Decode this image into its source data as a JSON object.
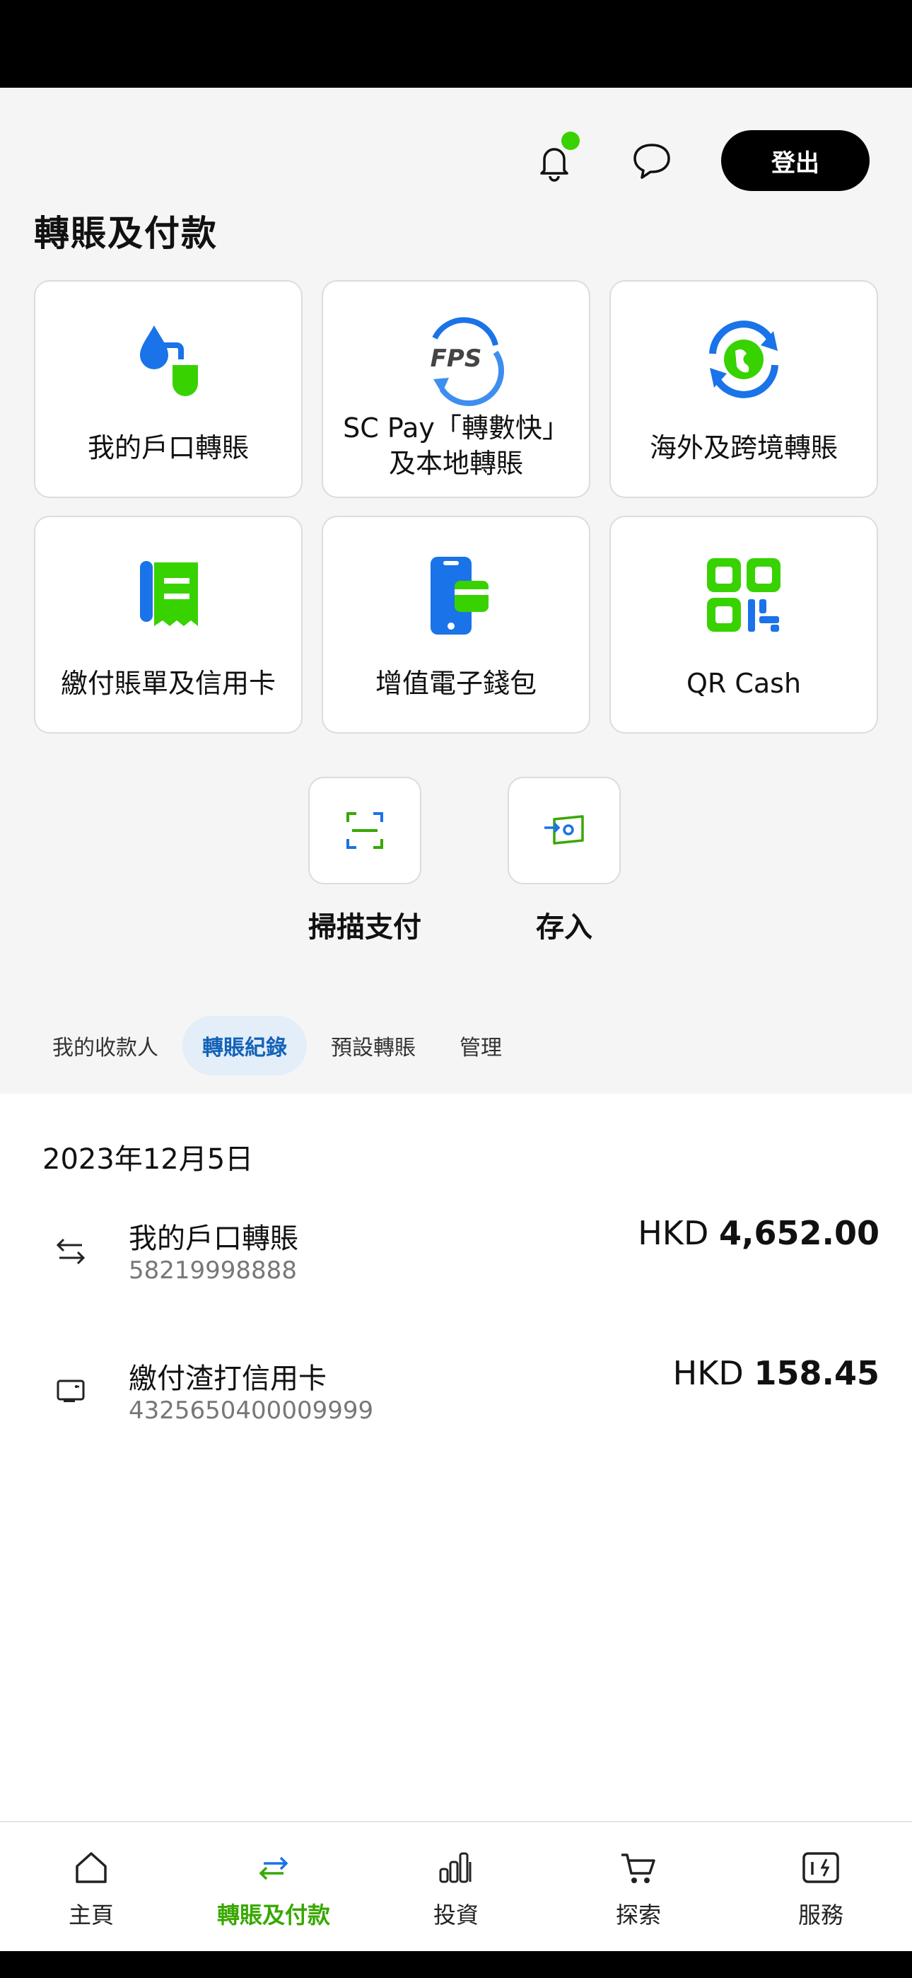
{
  "header": {
    "logout_label": "登出",
    "page_title": "轉賬及付款"
  },
  "tiles": [
    {
      "label": "我的戶口轉賬",
      "icon": "own-account-transfer-icon"
    },
    {
      "label_line1": "SC Pay「轉數快」",
      "label_line2": "及本地轉賬",
      "icon": "fps-icon",
      "logo_text": "FPS"
    },
    {
      "label": "海外及跨境轉賬",
      "icon": "overseas-transfer-icon"
    },
    {
      "label": "繳付賬單及信用卡",
      "icon": "bill-payment-icon"
    },
    {
      "label": "增值電子錢包",
      "icon": "ewallet-icon"
    },
    {
      "label": "QR Cash",
      "icon": "qr-code-icon"
    }
  ],
  "quick_actions": [
    {
      "label": "掃描支付",
      "icon": "scan-icon"
    },
    {
      "label": "存入",
      "icon": "deposit-icon"
    }
  ],
  "tabs": [
    {
      "label": "我的收款人",
      "active": false
    },
    {
      "label": "轉賬紀錄",
      "active": true
    },
    {
      "label": "預設轉賬",
      "active": false
    },
    {
      "label": "管理",
      "active": false
    }
  ],
  "history": {
    "date": "2023年12月5日",
    "transactions": [
      {
        "name": "我的戶口轉賬",
        "account": "58219998888",
        "currency": "HKD",
        "amount": "4,652.00",
        "icon": "transfer-arrows-icon"
      },
      {
        "name": "繳付渣打信用卡",
        "account": "4325650400009999",
        "currency": "HKD",
        "amount": "158.45",
        "icon": "credit-card-payment-icon"
      }
    ]
  },
  "bottom_nav": [
    {
      "label": "主頁",
      "icon": "home-icon",
      "active": false
    },
    {
      "label": "轉賬及付款",
      "icon": "transfer-icon",
      "active": true
    },
    {
      "label": "投資",
      "icon": "bar-chart-icon",
      "active": false
    },
    {
      "label": "探索",
      "icon": "cart-icon",
      "active": false
    },
    {
      "label": "服務",
      "icon": "services-icon",
      "active": false
    }
  ],
  "colors": {
    "brand_green": "#38d200",
    "brand_blue": "#1a73e8",
    "active_tab_bg": "#e3eef9",
    "active_tab_text": "#1462b8",
    "nav_active": "#38a800"
  }
}
